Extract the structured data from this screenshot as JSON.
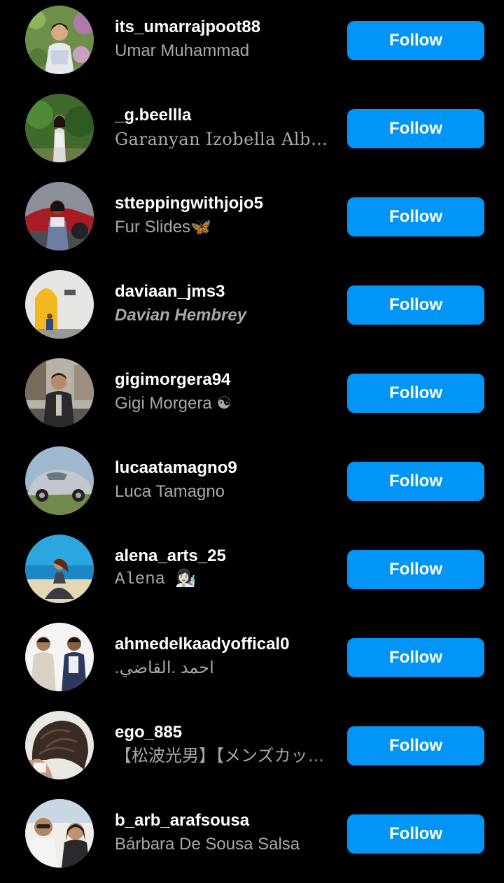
{
  "colors": {
    "background": "#000000",
    "username": "#ffffff",
    "fullname": "#a8a8a8",
    "follow_button": "#0095f6",
    "follow_text": "#ffffff"
  },
  "suggestions": [
    {
      "username": "its_umarrajpoot88",
      "full_name": "Umar Muhammad",
      "follow_label": "Follow",
      "avatar": "avatar-woman-floral-garden"
    },
    {
      "username": "_g.beellla",
      "full_name": "Garanyan Izobella Alber…",
      "follow_label": "Follow",
      "avatar": "avatar-woman-white-dress-garden"
    },
    {
      "username": "stteppingwithjojo5",
      "full_name": "Fur Slides🦋",
      "follow_label": "Follow",
      "avatar": "avatar-woman-red-car"
    },
    {
      "username": "daviaan_jms3",
      "full_name": "Davian Hembrey",
      "follow_label": "Follow",
      "avatar": "avatar-man-yellow-door"
    },
    {
      "username": "gigimorgera94",
      "full_name": "Gigi Morgera ☯",
      "follow_label": "Follow",
      "avatar": "avatar-man-jacket-street"
    },
    {
      "username": "lucaatamagno9",
      "full_name": "Luca Tamagno",
      "follow_label": "Follow",
      "avatar": "avatar-vintage-car"
    },
    {
      "username": "alena_arts_25",
      "full_name": "Alena 👩🏻‍🔬",
      "follow_label": "Follow",
      "avatar": "avatar-woman-beach"
    },
    {
      "username": "ahmedelkaadyoffical0",
      "full_name": ".احمد .القاضي",
      "follow_label": "Follow",
      "avatar": "avatar-two-men"
    },
    {
      "username": "ego_885",
      "full_name": "【松波光男】【メンズカッ…",
      "follow_label": "Follow",
      "avatar": "avatar-hair-closeup"
    },
    {
      "username": "b_arb_arafsousa",
      "full_name": "Bárbara De Sousa Salsa",
      "follow_label": "Follow",
      "avatar": "avatar-couple-selfie"
    }
  ]
}
